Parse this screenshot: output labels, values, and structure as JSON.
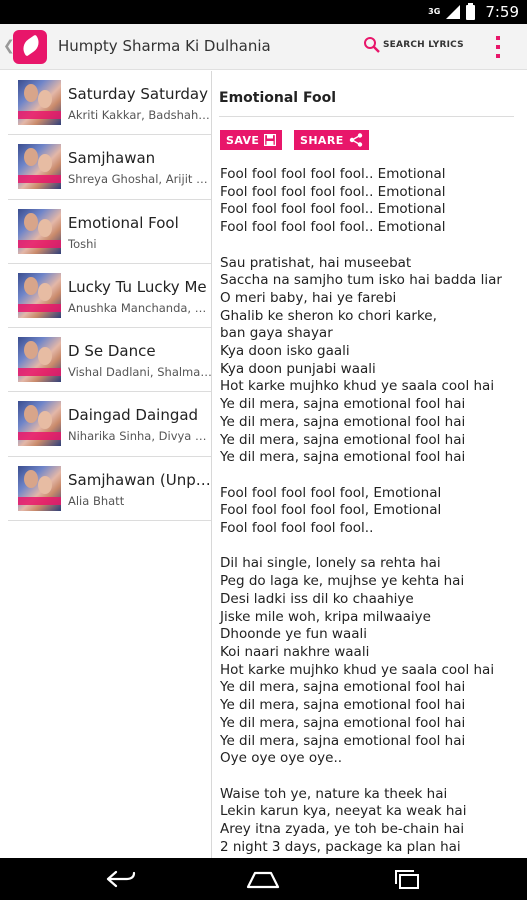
{
  "status_bar": {
    "network": "3G",
    "time": "7:59"
  },
  "action_bar": {
    "title": "Humpty Sharma Ki Dulhania",
    "search_label": "SEARCH LYRICS",
    "icons": [
      "back-chevron-icon",
      "feather-app-icon",
      "search-icon",
      "overflow-menu-icon"
    ],
    "accent_color": "#e8166a"
  },
  "songs": [
    {
      "title": "Saturday Saturday",
      "artist": "Akriti Kakkar, Badshah, Indeep Bakshi"
    },
    {
      "title": "Samjhawan",
      "artist": "Shreya Ghoshal, Arijit Singh"
    },
    {
      "title": "Emotional Fool",
      "artist": "Toshi"
    },
    {
      "title": "Lucky Tu Lucky Me",
      "artist": "Anushka Manchanda, Siddharth Mahadevan"
    },
    {
      "title": "D Se Dance",
      "artist": "Vishal Dadlani, Shalmali Kholgade"
    },
    {
      "title": "Daingad Daingad",
      "artist": "Niharika Sinha, Divya Kumar"
    },
    {
      "title": "Samjhawan (Unplugged)",
      "artist": "Alia Bhatt"
    }
  ],
  "lyrics_view": {
    "heading": "Emotional Fool",
    "save_label": "SAVE",
    "share_label": "SHARE",
    "text": "Fool fool fool fool fool.. Emotional\nFool fool fool fool fool.. Emotional\nFool fool fool fool fool.. Emotional\nFool fool fool fool fool.. Emotional\n\nSau pratishat, hai museebat\nSaccha na samjho tum isko hai badda liar\nO meri baby, hai ye farebi\nGhalib ke sheron ko chori karke,\nban gaya shayar\nKya doon isko gaali\nKya doon punjabi waali\nHot karke mujhko khud ye saala cool hai\nYe dil mera, sajna emotional fool hai\nYe dil mera, sajna emotional fool hai\nYe dil mera, sajna emotional fool hai\nYe dil mera, sajna emotional fool hai\n\nFool fool fool fool fool, Emotional\nFool fool fool fool fool, Emotional\nFool fool fool fool fool..\n\nDil hai single, lonely sa rehta hai\nPeg do laga ke, mujhse ye kehta hai\nDesi ladki iss dil ko chaahiye\nJiske mile woh, kripa milwaaiye\nDhoonde ye fun waali\nKoi naari nakhre waali\nHot karke mujhko khud ye saala cool hai\nYe dil mera, sajna emotional fool hai\nYe dil mera, sajna emotional fool hai\nYe dil mera, sajna emotional fool hai\nYe dil mera, sajna emotional fool hai\nOye oye oye oye..\n\nWaise toh ye, nature ka theek hai\nLekin karun kya, neeyat ka weak hai\nArey itna zyada, ye toh be-chain hai\n2 night 3 days, package ka plan hai\nKarta jaaye kharabi"
  },
  "nav_bar": {
    "icons": [
      "back-icon",
      "home-icon",
      "recents-icon"
    ]
  }
}
